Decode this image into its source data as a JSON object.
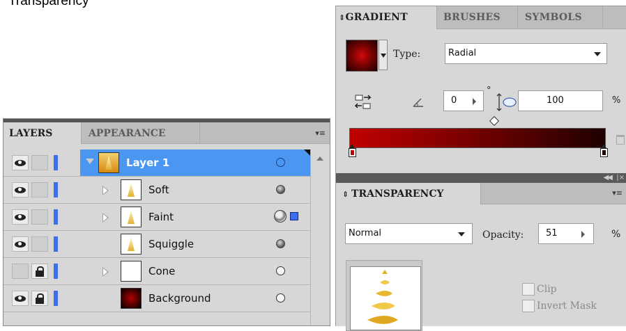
{
  "caption": "Transparency",
  "gradient_panel": {
    "tabs": [
      "GRADIENT",
      "BRUSHES",
      "SYMBOLS"
    ],
    "type_label": "Type:",
    "type_value": "Radial",
    "angle_value": "0",
    "degree_symbol": "°",
    "aspect_value": "100",
    "percent": "%",
    "stop_colors": [
      "#c00000",
      "#1e0000"
    ]
  },
  "transparency_panel": {
    "title": "TRANSPARENCY",
    "blend_mode": "Normal",
    "opacity_label": "Opacity:",
    "opacity_value": "51",
    "percent": "%",
    "clip_label": "Clip",
    "invert_mask_label": "Invert Mask"
  },
  "layers_panel": {
    "tabs": [
      "LAYERS",
      "APPEARANCE"
    ],
    "layers": [
      {
        "name": "Layer 1",
        "selected": true
      },
      {
        "name": "Soft"
      },
      {
        "name": "Faint"
      },
      {
        "name": "Squiggle"
      },
      {
        "name": "Cone"
      },
      {
        "name": "Background"
      }
    ]
  }
}
